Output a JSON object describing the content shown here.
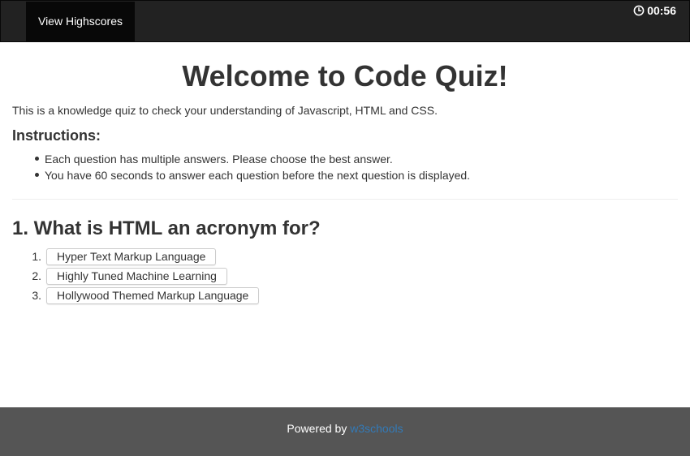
{
  "navbar": {
    "highscores_label": "View Highscores",
    "timer": "00:56",
    "timer_icon": "clock-icon"
  },
  "main": {
    "title": "Welcome to Code Quiz!",
    "intro": "This is a knowledge quiz to check your understanding of Javascript, HTML and CSS.",
    "instructions_heading": "Instructions:",
    "instructions": [
      "Each question has multiple answers. Please choose the best answer.",
      "You have 60 seconds to answer each question before the next question is displayed."
    ]
  },
  "question": {
    "text": "1. What is HTML an acronym for?",
    "answers": [
      {
        "number": "1.",
        "label": "Hyper Text Markup Language"
      },
      {
        "number": "2.",
        "label": "Highly Tuned Machine Learning"
      },
      {
        "number": "3.",
        "label": "Hollywood Themed Markup Language"
      }
    ]
  },
  "footer": {
    "prefix": "Powered by ",
    "link_text": "w3schools"
  },
  "colors": {
    "navbar_bg": "#222222",
    "footer_bg": "#555555",
    "link": "#337ab7"
  }
}
